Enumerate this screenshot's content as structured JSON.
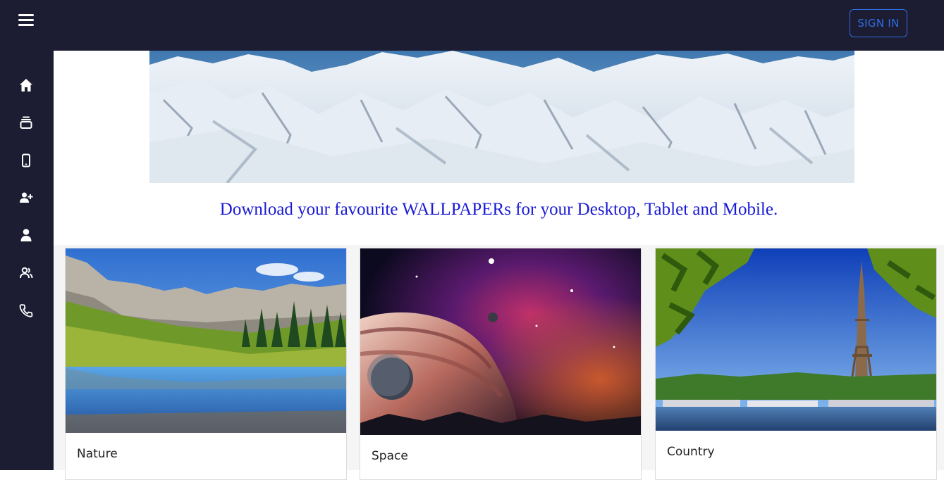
{
  "header": {
    "menu_icon": "hamburger-icon",
    "signin_label": "SIGN IN"
  },
  "sidebar": {
    "items": [
      {
        "icon": "home-icon"
      },
      {
        "icon": "layers-icon"
      },
      {
        "icon": "mobile-icon"
      },
      {
        "icon": "user-plus-icon"
      },
      {
        "icon": "user-icon"
      },
      {
        "icon": "users-icon"
      },
      {
        "icon": "phone-icon"
      }
    ]
  },
  "banner": {
    "image": "snowy-mountain-panorama"
  },
  "tagline": "Download your favourite WALLPAPERs for your Desktop, Tablet and Mobile.",
  "cards": [
    {
      "title": "Nature",
      "image": "mountain-lake-landscape"
    },
    {
      "title": "Space",
      "image": "galaxy-planets"
    },
    {
      "title": "Country",
      "image": "eiffel-tower-paris"
    }
  ],
  "colors": {
    "nav_bg": "#1c1c33",
    "accent": "#2f6fe4",
    "tagline": "#1a1ad6"
  }
}
